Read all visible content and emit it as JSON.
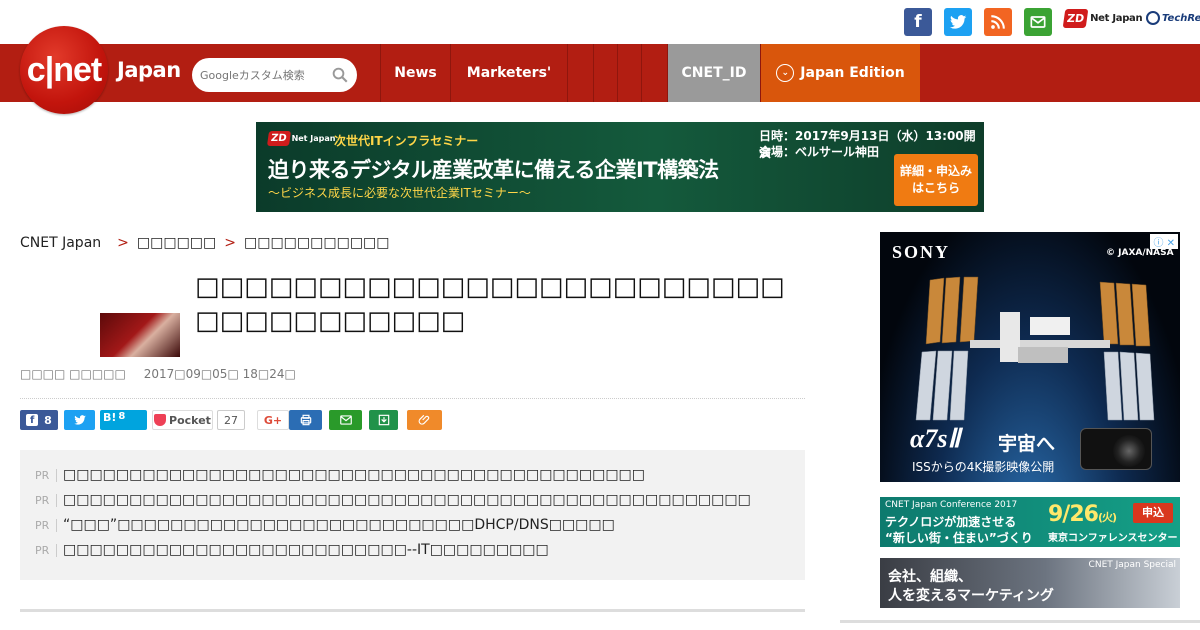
{
  "social": {
    "facebook_glyph": "f",
    "zdnet_badge": "ZD",
    "zdnet_label": "Net Japan",
    "techrepublic_label": "TechRep"
  },
  "nav": {
    "logo_text": "c|net",
    "logo_word": "Japan",
    "search_placeholder": "Googleカスタム検索",
    "items": [
      "News",
      "Marketers'"
    ],
    "cnet_id": "CNET_ID",
    "japan_edition": "Japan Edition"
  },
  "banner": {
    "zd_badge": "ZD",
    "zd_label": "Net Japan",
    "series": "次世代ITインフラセミナー",
    "headline": "迫り来るデジタル産業改革に備える企業IT構築法",
    "subline": "〜ビジネス成長に必要な次世代企業ITセミナー〜",
    "date": "日時：2017年9月13日（水）13:00開演",
    "venue": "会場：ベルサール神田",
    "cta_line1": "詳細・申込み",
    "cta_line2": "はこちら"
  },
  "breadcrumb": {
    "home": "CNET Japan",
    "sep1": ">",
    "level1": "□□□□□□",
    "sep2": ">",
    "level2": "□□□□□□□□□□□"
  },
  "article": {
    "title": "□□□□□□□□□□□□□□□□□□□□□□□□□□□□□□□□□□□",
    "author": "□□□□ □□□□□",
    "date": "2017□09□05□ 18□24□"
  },
  "share": {
    "facebook_count": "8",
    "hatena_label": "B!",
    "hatena_count": "8",
    "pocket_label": "Pocket",
    "pocket_count": "27",
    "gplus_label": "G+"
  },
  "pr": {
    "tag": "PR",
    "links": [
      "□□□□□□□□□□□□□□□□□□□□□□□□□□□□□□□□□□□□□□□□□□□□",
      "□□□□□□□□□□□□□□□□□□□□□□□□□□□□□□□□□□□□□□□□□□□□□□□□□□□□",
      "“□□□”□□□□□□□□□□□□□□□□□□□□□□□□□□□DHCP/DNS□□□□□",
      "□□□□□□□□□□□□□□□□□□□□□□□□□□--IT□□□□□□□□□"
    ]
  },
  "ads": {
    "adchoice": "ⓘ ✕",
    "sony_logo": "SONY",
    "sony_credit": "© JAXA/NASA",
    "sony_model": "α7sⅡ",
    "sony_tagline": "宇宙へ",
    "sony_sub": "ISSからの4K撮影映像公開",
    "conf_top": "CNET Japan Conference 2017",
    "conf_line1": "テクノロジが加速させる",
    "conf_line2": "“新しい街・住まい”づくり",
    "conf_date": "9/26",
    "conf_day": "(火)",
    "conf_btn": "申込",
    "conf_venue": "東京コンファレンスセンター",
    "special_tag": "CNET Japan Special",
    "special_line1": "会社、組織、",
    "special_line2": "人を変えるマーケティング"
  },
  "colors": {
    "nav_red": "#b21e12",
    "facebook": "#3b5998",
    "twitter": "#1da1f2",
    "rss": "#f26522",
    "mail": "#3ba334",
    "japan_edition": "#d9560c",
    "cnet_id": "#9a9a9a"
  }
}
